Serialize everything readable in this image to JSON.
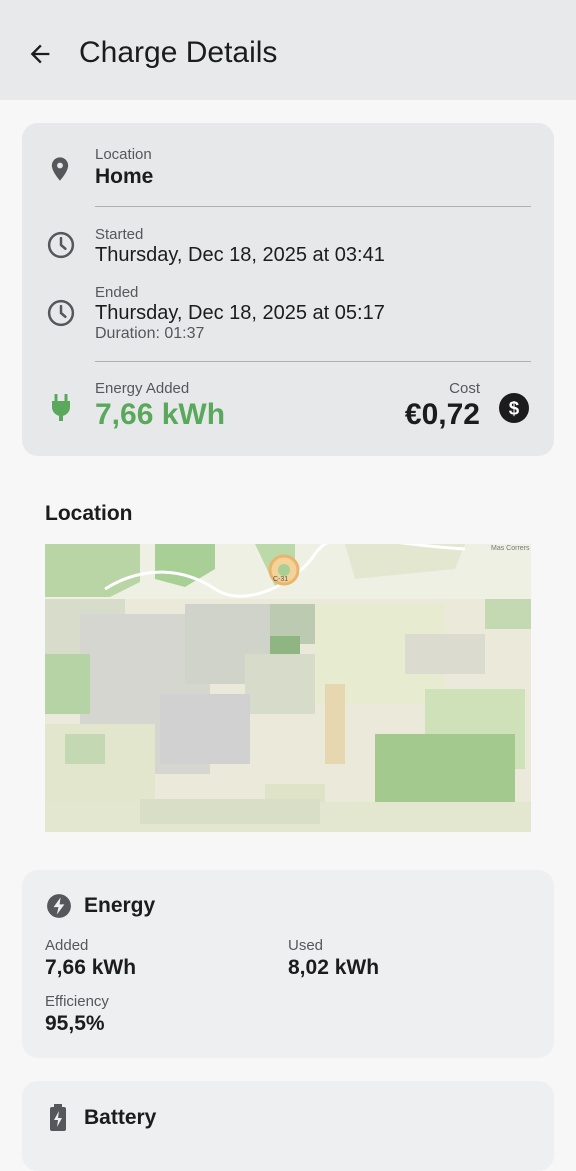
{
  "header": {
    "title": "Charge Details"
  },
  "summary": {
    "location_label": "Location",
    "location_value": "Home",
    "started_label": "Started",
    "started_value": "Thursday, Dec 18, 2025 at 03:41",
    "ended_label": "Ended",
    "ended_value": "Thursday, Dec 18, 2025 at 05:17",
    "duration": "Duration: 01:37",
    "energy_label": "Energy Added",
    "energy_value": "7,66 kWh",
    "cost_label": "Cost",
    "cost_value": "€0,72"
  },
  "location_section": {
    "title": "Location",
    "map_labels": [
      "C-31",
      "Mas Corrers"
    ]
  },
  "energy": {
    "title": "Energy",
    "added_label": "Added",
    "added_value": "7,66 kWh",
    "used_label": "Used",
    "used_value": "8,02 kWh",
    "efficiency_label": "Efficiency",
    "efficiency_value": "95,5%"
  },
  "battery": {
    "title": "Battery"
  },
  "colors": {
    "accent_green": "#5aa85b",
    "card_bg": "#e7e8ea",
    "appbar_bg": "#e8e9eb"
  },
  "icons": [
    "back-arrow-icon",
    "location-pin-icon",
    "clock-icon",
    "plug-icon",
    "dollar-icon",
    "energy-bolt-icon",
    "battery-icon"
  ]
}
